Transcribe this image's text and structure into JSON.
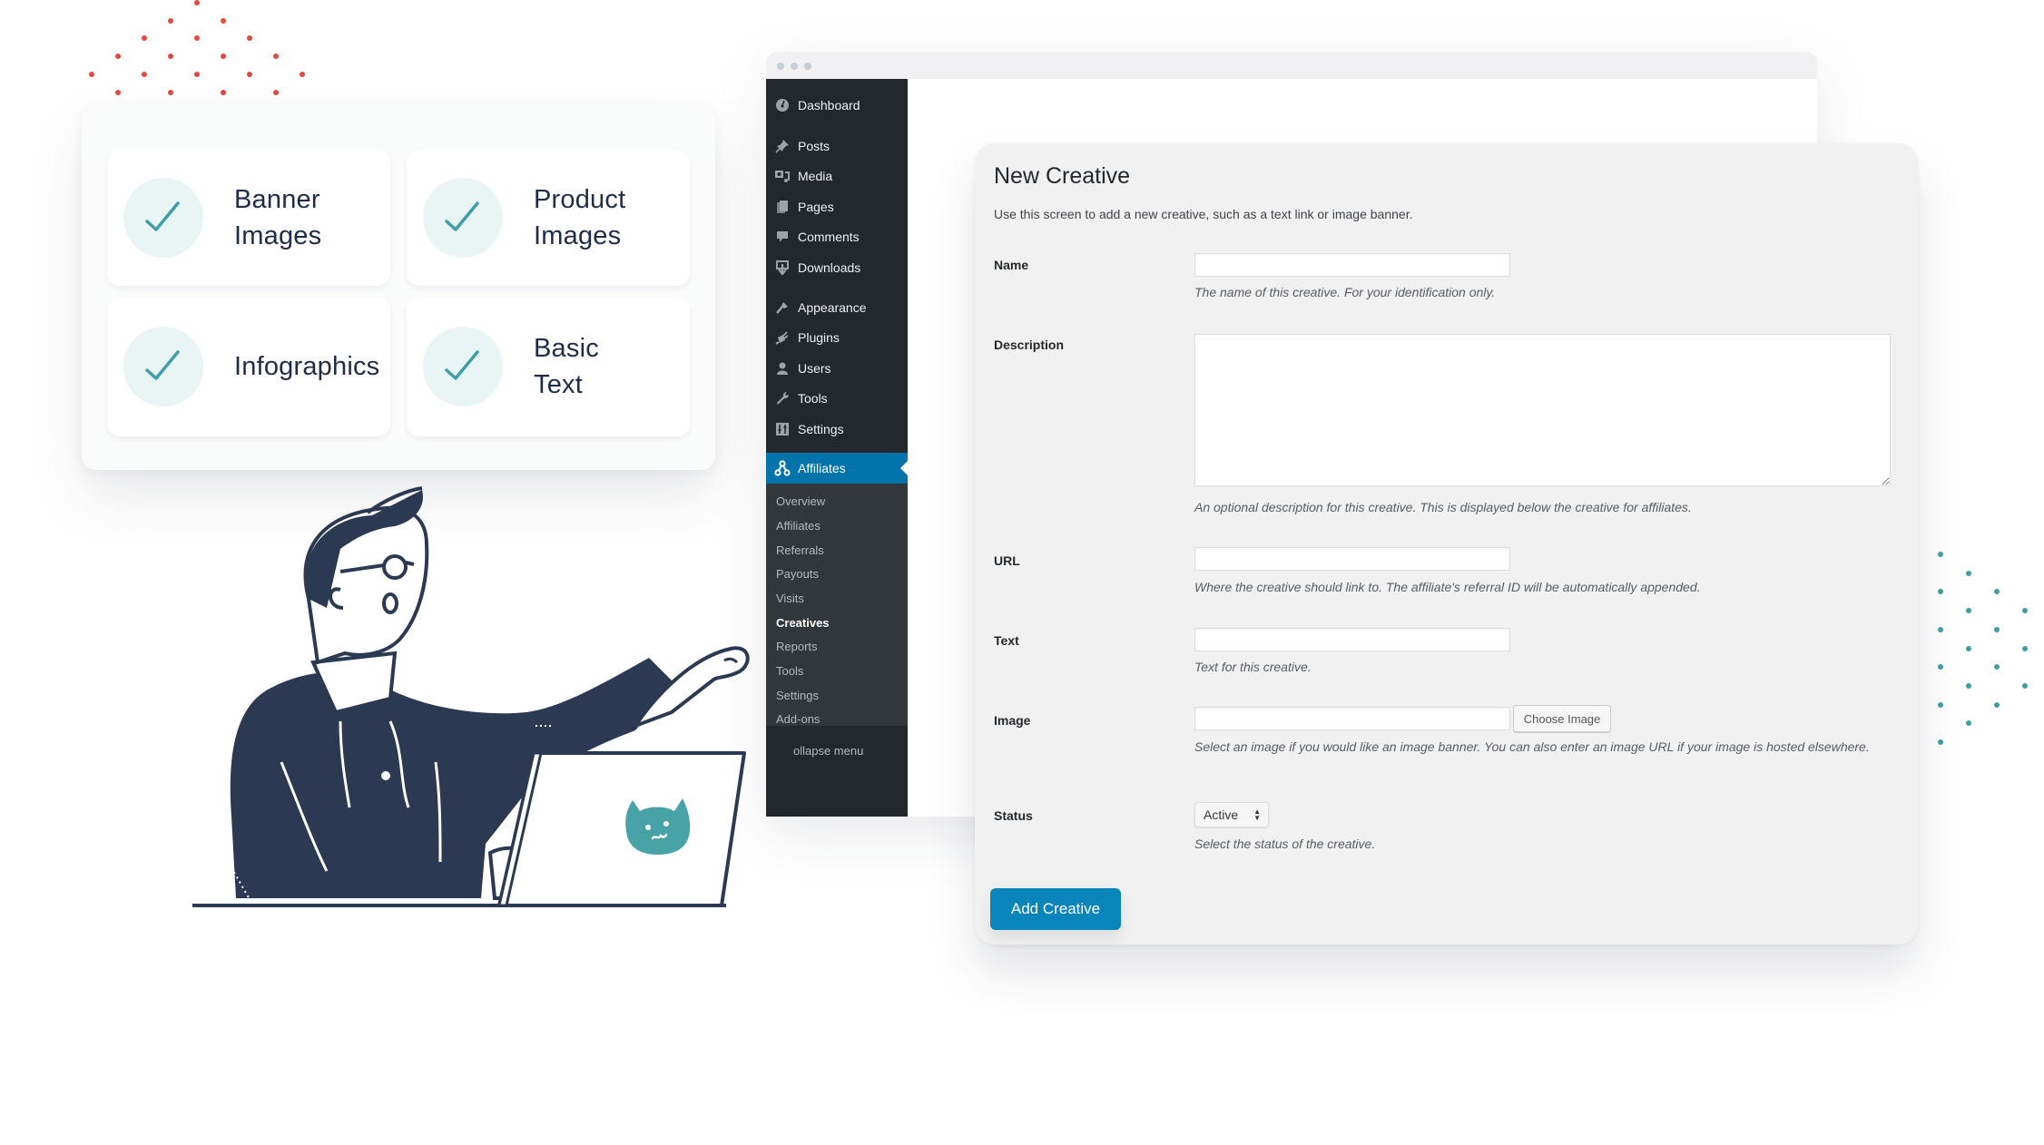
{
  "features": [
    {
      "label": "Banner Images",
      "icon": "check-icon"
    },
    {
      "label": "Product Images",
      "icon": "check-icon"
    },
    {
      "label": "Infographics",
      "icon": "check-icon"
    },
    {
      "label": "Basic Text",
      "icon": "check-icon"
    }
  ],
  "colors": {
    "accent_red": "#e4483f",
    "accent_teal": "#3f9fa6",
    "sidebar_bg": "#23282d",
    "sidebar_active": "#0073aa",
    "primary_button": "#0a85bb",
    "illustration_navy": "#2b3a52"
  },
  "sidebar": {
    "items": [
      {
        "label": "Dashboard",
        "icon": "dashboard-icon"
      },
      {
        "label": "Posts",
        "icon": "pin-icon"
      },
      {
        "label": "Media",
        "icon": "media-icon"
      },
      {
        "label": "Pages",
        "icon": "pages-icon"
      },
      {
        "label": "Comments",
        "icon": "comment-icon"
      },
      {
        "label": "Downloads",
        "icon": "download-icon"
      },
      {
        "label": "Appearance",
        "icon": "brush-icon"
      },
      {
        "label": "Plugins",
        "icon": "plugin-icon"
      },
      {
        "label": "Users",
        "icon": "user-icon"
      },
      {
        "label": "Tools",
        "icon": "wrench-icon"
      },
      {
        "label": "Settings",
        "icon": "settings-icon"
      },
      {
        "label": "Affiliates",
        "icon": "affiliates-icon",
        "active": true
      }
    ],
    "submenu": [
      "Overview",
      "Affiliates",
      "Referrals",
      "Payouts",
      "Visits",
      "Creatives",
      "Reports",
      "Tools",
      "Settings",
      "Add-ons"
    ],
    "submenu_current": "Creatives",
    "collapse_label": "ollapse menu"
  },
  "form": {
    "title": "New Creative",
    "intro": "Use this screen to add a new creative, such as a text link or image banner.",
    "fields": {
      "name": {
        "label": "Name",
        "value": "",
        "help": "The name of this creative. For your identification only."
      },
      "description": {
        "label": "Description",
        "value": "",
        "help": "An optional description for this creative. This is displayed below the creative for affiliates."
      },
      "url": {
        "label": "URL",
        "value": "",
        "help": "Where the creative should link to. The affiliate's referral ID will be automatically appended."
      },
      "text": {
        "label": "Text",
        "value": "",
        "help": "Text for this creative."
      },
      "image": {
        "label": "Image",
        "value": "",
        "button": "Choose Image",
        "help": "Select an image if you would like an image banner. You can also enter an image URL if your image is hosted elsewhere."
      },
      "status": {
        "label": "Status",
        "value": "Active",
        "help": "Select the status of the creative."
      }
    },
    "submit_label": "Add Creative"
  }
}
